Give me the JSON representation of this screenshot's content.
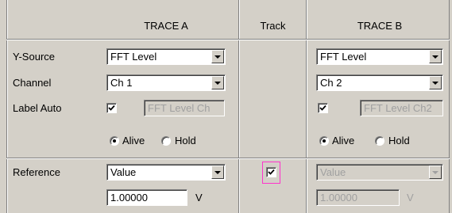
{
  "headers": {
    "trace_a": "TRACE A",
    "track": "Track",
    "trace_b": "TRACE B"
  },
  "rows": {
    "y_source": "Y-Source",
    "channel": "Channel",
    "label_auto": "Label Auto",
    "reference": "Reference"
  },
  "trace_a": {
    "y_source": "FFT Level",
    "channel": "Ch 1",
    "label_auto_checked": true,
    "label_text": "FFT Level Ch",
    "mode_options": [
      "Alive",
      "Hold"
    ],
    "mode_selected": "Alive",
    "reference": "Value",
    "reference_value": "1.00000",
    "reference_unit": "V"
  },
  "track": {
    "checked": true
  },
  "trace_b": {
    "y_source": "FFT Level",
    "channel": "Ch 2",
    "label_auto_checked": true,
    "label_text": "FFT Level Ch2",
    "mode_options": [
      "Alive",
      "Hold"
    ],
    "mode_selected": "Alive",
    "reference": "Value",
    "reference_value": "1.00000",
    "reference_unit": "V"
  },
  "colors": {
    "background": "#d4d0c8",
    "focus": "#ff33cc",
    "disabled_text": "#a0a0a0"
  }
}
